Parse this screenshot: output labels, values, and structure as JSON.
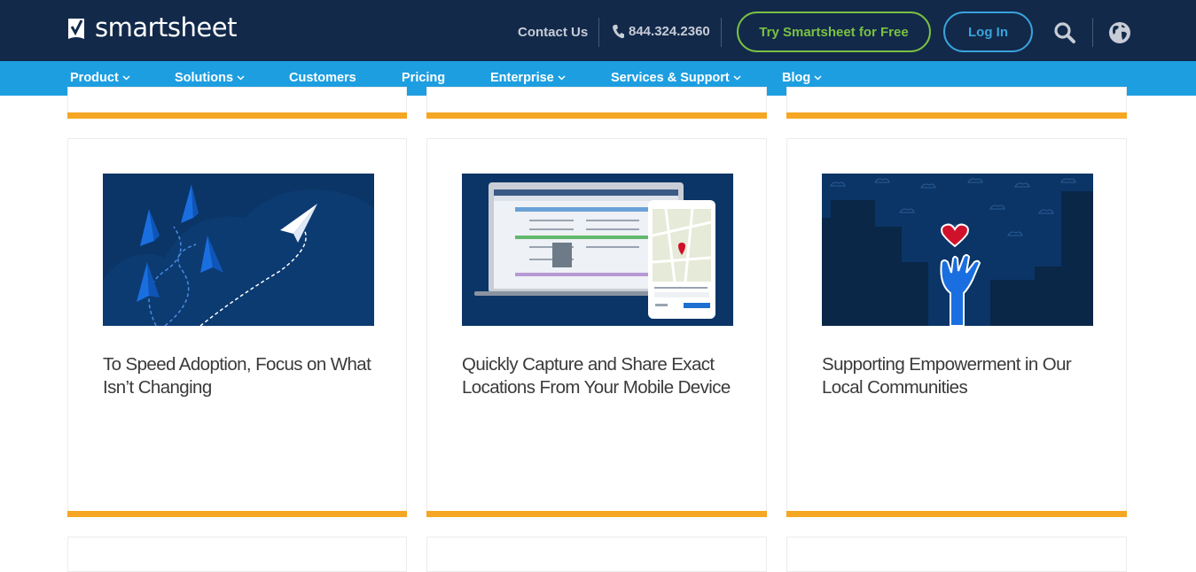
{
  "header": {
    "logo_text": "smartsheet",
    "contact_label": "Contact Us",
    "phone": "844.324.2360",
    "try_label": "Try Smartsheet for Free",
    "login_label": "Log In",
    "icons": [
      "checkmark-logo-icon",
      "phone-icon",
      "search-icon",
      "globe-icon"
    ]
  },
  "nav": {
    "items": [
      {
        "label": "Product",
        "dropdown": true
      },
      {
        "label": "Solutions",
        "dropdown": true
      },
      {
        "label": "Customers",
        "dropdown": false
      },
      {
        "label": "Pricing",
        "dropdown": false
      },
      {
        "label": "Enterprise",
        "dropdown": true
      },
      {
        "label": "Services & Support",
        "dropdown": true
      },
      {
        "label": "Blog",
        "dropdown": true
      }
    ]
  },
  "cards": [
    {
      "title": "To Speed Adoption, Focus on What Isn’t Changing",
      "image": "paper-airplanes-illustration"
    },
    {
      "title": "Quickly Capture and Share Exact Locations From Your Mobile Device",
      "image": "laptop-and-tablet-map-illustration"
    },
    {
      "title": "Supporting Empowerment in Our Local Communities",
      "image": "hand-holding-heart-illustration"
    }
  ],
  "colors": {
    "header_bg": "#12294a",
    "nav_bg": "#1d9ee0",
    "try_green": "#7ac142",
    "login_blue": "#3aa3dc",
    "card_accent": "#f5a623",
    "card_image_bg": "#0b3566"
  }
}
